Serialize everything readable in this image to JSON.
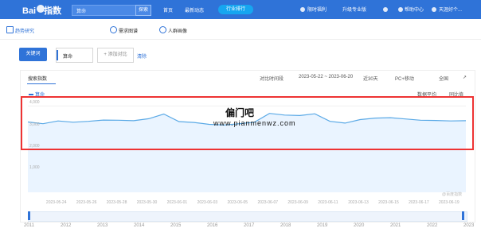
{
  "topbar": {
    "logo": "Bai",
    "logo2": "指数",
    "search_value": "算命",
    "search_button": "探索",
    "nav": [
      "首页",
      "最新动态"
    ],
    "rank_button": "行业排行",
    "right": [
      "限时福利",
      "升级专业版",
      "帮助中心",
      "天涯好个..."
    ]
  },
  "tabs": [
    "趋势研究",
    "需求图谱",
    "人群画像"
  ],
  "keywords": {
    "button": "关键词",
    "value": "算命",
    "add": "+ 添加对比",
    "clear": "清除"
  },
  "chart": {
    "title": "搜索指数",
    "controls": {
      "compare": "对比时间段",
      "range": "2023-05-22 ~ 2023-06-20",
      "days": "近30天",
      "device": "PC+移动",
      "region": "全国"
    },
    "legend": "算命",
    "checks": [
      "数据平均",
      "同比值"
    ],
    "y_ticks": [
      "4,000",
      "3,000",
      "2,000",
      "1,000"
    ],
    "x_ticks": [
      "2023-05-24",
      "2023-05-26",
      "2023-05-28",
      "2023-05-30",
      "2023-06-01",
      "2023-06-03",
      "2023-06-05",
      "2023-06-07",
      "2023-06-09",
      "2023-06-11",
      "2023-06-13",
      "2023-06-15",
      "2023-06-17",
      "2023-06-19"
    ],
    "source": "@百度指数",
    "years": [
      "2011",
      "2012",
      "2013",
      "2014",
      "2015",
      "2016",
      "2017",
      "2018",
      "2019",
      "2020",
      "2021",
      "2022",
      "2023"
    ]
  },
  "watermark": {
    "title": "偏门吧",
    "url": "www.pianmenwz.com"
  },
  "chart_data": {
    "type": "area",
    "title": "搜索指数",
    "xlabel": "",
    "ylabel": "",
    "ylim": [
      0,
      4200
    ],
    "x": [
      "2023-05-22",
      "2023-05-23",
      "2023-05-24",
      "2023-05-25",
      "2023-05-26",
      "2023-05-27",
      "2023-05-28",
      "2023-05-29",
      "2023-05-30",
      "2023-05-31",
      "2023-06-01",
      "2023-06-02",
      "2023-06-03",
      "2023-06-04",
      "2023-06-05",
      "2023-06-06",
      "2023-06-07",
      "2023-06-08",
      "2023-06-09",
      "2023-06-10",
      "2023-06-11",
      "2023-06-12",
      "2023-06-13",
      "2023-06-14",
      "2023-06-15",
      "2023-06-16",
      "2023-06-17",
      "2023-06-18",
      "2023-06-19",
      "2023-06-20"
    ],
    "series": [
      {
        "name": "算命",
        "values": [
          3260,
          3180,
          3310,
          3250,
          3290,
          3350,
          3340,
          3320,
          3410,
          3630,
          3280,
          3240,
          3150,
          3120,
          3180,
          3250,
          3660,
          3580,
          3560,
          3640,
          3290,
          3210,
          3370,
          3440,
          3460,
          3400,
          3340,
          3330,
          3310,
          3320
        ]
      }
    ]
  }
}
